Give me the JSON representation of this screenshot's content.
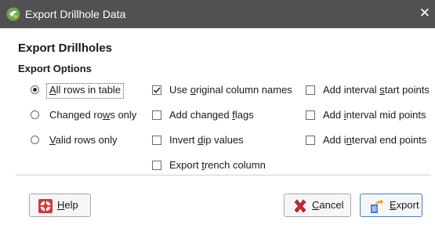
{
  "window": {
    "title": "Export Drillhole Data",
    "close_glyph": "✕"
  },
  "heading": "Export Drillholes",
  "subheading": "Export Options",
  "rows_group": [
    {
      "pre": "",
      "mn": "A",
      "post": "ll rows in table",
      "checked": true
    },
    {
      "pre": "Changed ro",
      "mn": "w",
      "post": "s only",
      "checked": false
    },
    {
      "pre": "",
      "mn": "V",
      "post": "alid rows only",
      "checked": false
    }
  ],
  "column_options": [
    {
      "pre": "Use ",
      "mn": "o",
      "post": "riginal column names",
      "checked": true
    },
    {
      "pre": "Add changed ",
      "mn": "f",
      "post": "lags",
      "checked": false
    },
    {
      "pre": "Invert ",
      "mn": "d",
      "post": "ip values",
      "checked": false
    },
    {
      "pre": "Export ",
      "mn": "t",
      "post": "rench column",
      "checked": false
    }
  ],
  "interval_options": [
    {
      "pre": "Add interval ",
      "mn": "s",
      "post": "tart points",
      "checked": false
    },
    {
      "pre": "Add ",
      "mn": "i",
      "post": "nterval mid points",
      "checked": false
    },
    {
      "pre": "Add i",
      "mn": "n",
      "post": "terval end points",
      "checked": false
    }
  ],
  "buttons": {
    "help": {
      "mn": "H",
      "post": "elp",
      "icon": "lifebuoy-icon"
    },
    "cancel": {
      "mn": "C",
      "post": "ancel",
      "icon": "red-x-icon"
    },
    "export": {
      "mn": "E",
      "post": "xport",
      "icon": "export-arrow-icon"
    }
  },
  "colors": {
    "titlebar": "#515151",
    "focus_border": "#4a7fbf",
    "help_red": "#d03a3a",
    "cancel_red": "#c62828"
  }
}
